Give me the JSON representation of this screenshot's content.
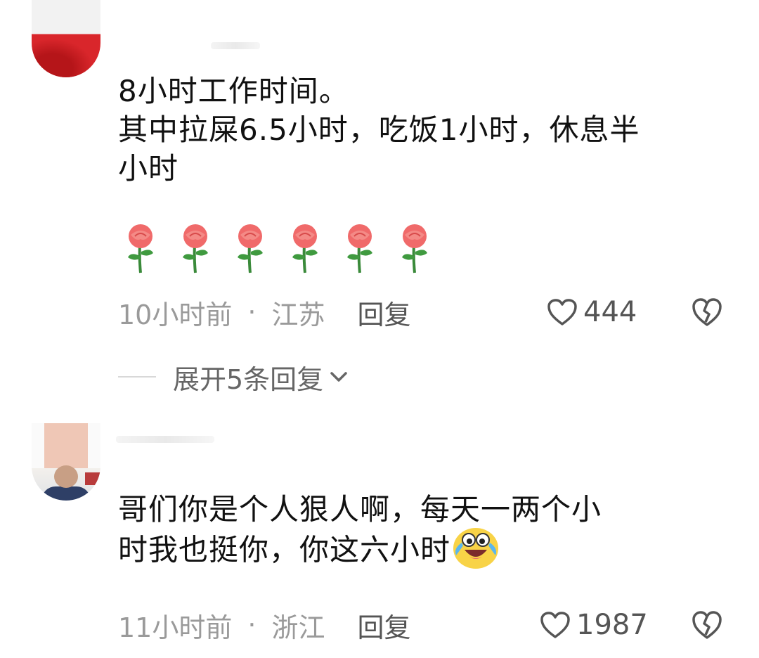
{
  "comments": [
    {
      "text": "8小时工作时间。\n其中拉屎6.5小时，吃饭1小时，休息半\n小时",
      "time": "10小时前",
      "location": "江苏",
      "reply_label": "回复",
      "likes": "444",
      "expand_label": "展开5条回复",
      "emoji_icons": [
        "rose-icon",
        "rose-icon",
        "rose-icon",
        "rose-icon",
        "rose-icon",
        "rose-icon"
      ]
    },
    {
      "text": "哥们你是个人狠人啊，每天一两个小\n时我也挺你，你这六小时",
      "emoji_icon": "crying-laughing-icon",
      "time": "11小时前",
      "location": "浙江",
      "reply_label": "回复",
      "likes": "1987"
    }
  ],
  "separator": "·",
  "colors": {
    "text": "#111111",
    "meta": "#9a9a9a",
    "action": "#555555",
    "divider": "#d8d8d8"
  }
}
